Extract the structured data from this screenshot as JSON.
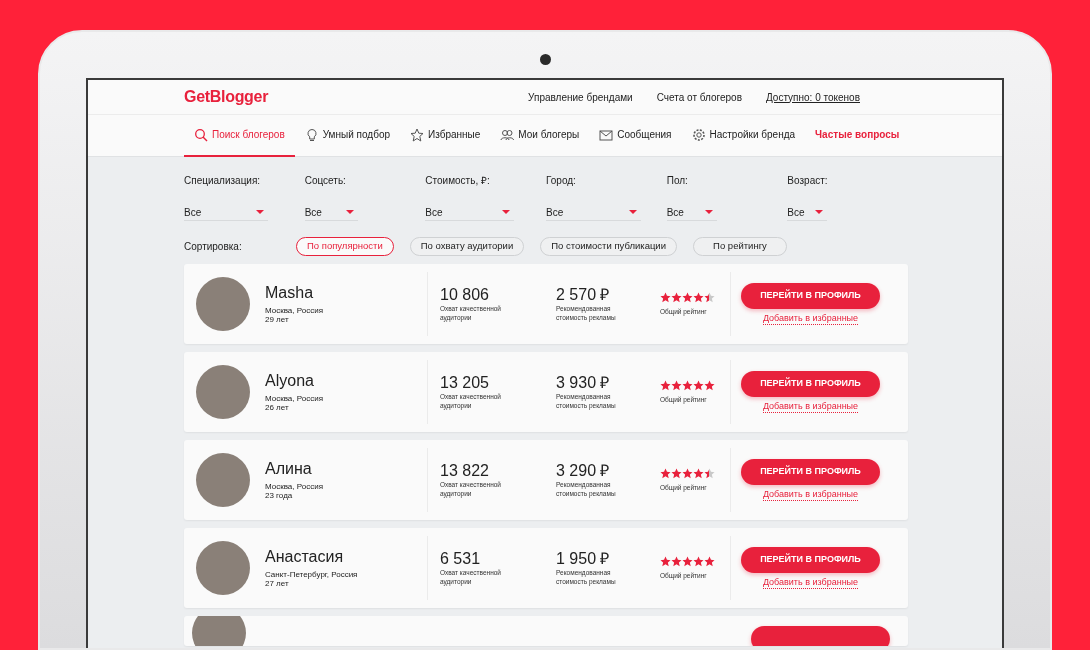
{
  "header": {
    "logo": "GetBlogger",
    "links": [
      {
        "label": "Управление брендами",
        "underlined": false
      },
      {
        "label": "Счета от блогеров",
        "underlined": false
      },
      {
        "label": "Доступно: 0 токенов",
        "underlined": true
      }
    ]
  },
  "nav": [
    {
      "label": "Поиск блогеров",
      "selected": true,
      "kind": "search"
    },
    {
      "label": "Умный подбор",
      "selected": false,
      "kind": "bulb"
    },
    {
      "label": "Избранные",
      "selected": false,
      "kind": "star"
    },
    {
      "label": "Мои блогеры",
      "selected": false,
      "kind": "people"
    },
    {
      "label": "Сообщения",
      "selected": false,
      "kind": "mail"
    },
    {
      "label": "Настройки бренда",
      "selected": false,
      "kind": "gear"
    },
    {
      "label": "Частые вопросы",
      "selected": false,
      "kind": "highlight"
    }
  ],
  "filters": [
    {
      "label": "Специализация:",
      "value": "Все"
    },
    {
      "label": "Соцсеть:",
      "value": "Все"
    },
    {
      "label": "Стоимость, ₽:",
      "value": "Все"
    },
    {
      "label": "Город:",
      "value": "Все"
    },
    {
      "label": "Пол:",
      "value": "Все"
    },
    {
      "label": "Возраст:",
      "value": "Все"
    }
  ],
  "sort": {
    "label": "Сортировка:",
    "options": [
      {
        "label": "По популярности",
        "selected": true
      },
      {
        "label": "По охвату аудитории",
        "selected": false
      },
      {
        "label": "По стоимости публикации",
        "selected": false
      },
      {
        "label": "По рейтингу",
        "selected": false
      }
    ]
  },
  "bloggers": [
    {
      "kind": "full",
      "name": "Masha",
      "city": "Москва, Россия",
      "age": "29 лет",
      "reach": "10 806",
      "reach_label": "Охват качественной аудитории",
      "price": "2 570 ₽",
      "price_label": "Рекомендованная стоимость рекламы",
      "stars": 4.5,
      "rating_label": "Общий рейтинг",
      "button": "ПЕРЕЙТИ В ПРОФИЛЬ",
      "favorite": "Добавить в избранные"
    },
    {
      "kind": "full",
      "name": "Alyona",
      "city": "Москва, Россия",
      "age": "26 лет",
      "reach": "13 205",
      "reach_label": "Охват качественной аудитории",
      "price": "3 930 ₽",
      "price_label": "Рекомендованная стоимость рекламы",
      "stars": 5,
      "rating_label": "Общий рейтинг",
      "button": "ПЕРЕЙТИ В ПРОФИЛЬ",
      "favorite": "Добавить в избранные"
    },
    {
      "kind": "full",
      "name": "Алина",
      "city": "Москва, Россия",
      "age": "23 года",
      "reach": "13 822",
      "reach_label": "Охват качественной аудитории",
      "price": "3 290 ₽",
      "price_label": "Рекомендованная стоимость рекламы",
      "stars": 4.5,
      "rating_label": "Общий рейтинг",
      "button": "ПЕРЕЙТИ В ПРОФИЛЬ",
      "favorite": "Добавить в избранные"
    },
    {
      "kind": "full",
      "name": "Анастасия",
      "city": "Санкт-Петербург, Россия",
      "age": "27 лет",
      "reach": "6 531",
      "reach_label": "Охват качественной аудитории",
      "price": "1 950 ₽",
      "price_label": "Рекомендованная стоимость рекламы",
      "stars": 5,
      "rating_label": "Общий рейтинг",
      "button": "ПЕРЕЙТИ В ПРОФИЛЬ",
      "favorite": "Добавить в избранные"
    },
    {
      "kind": "cut"
    }
  ]
}
